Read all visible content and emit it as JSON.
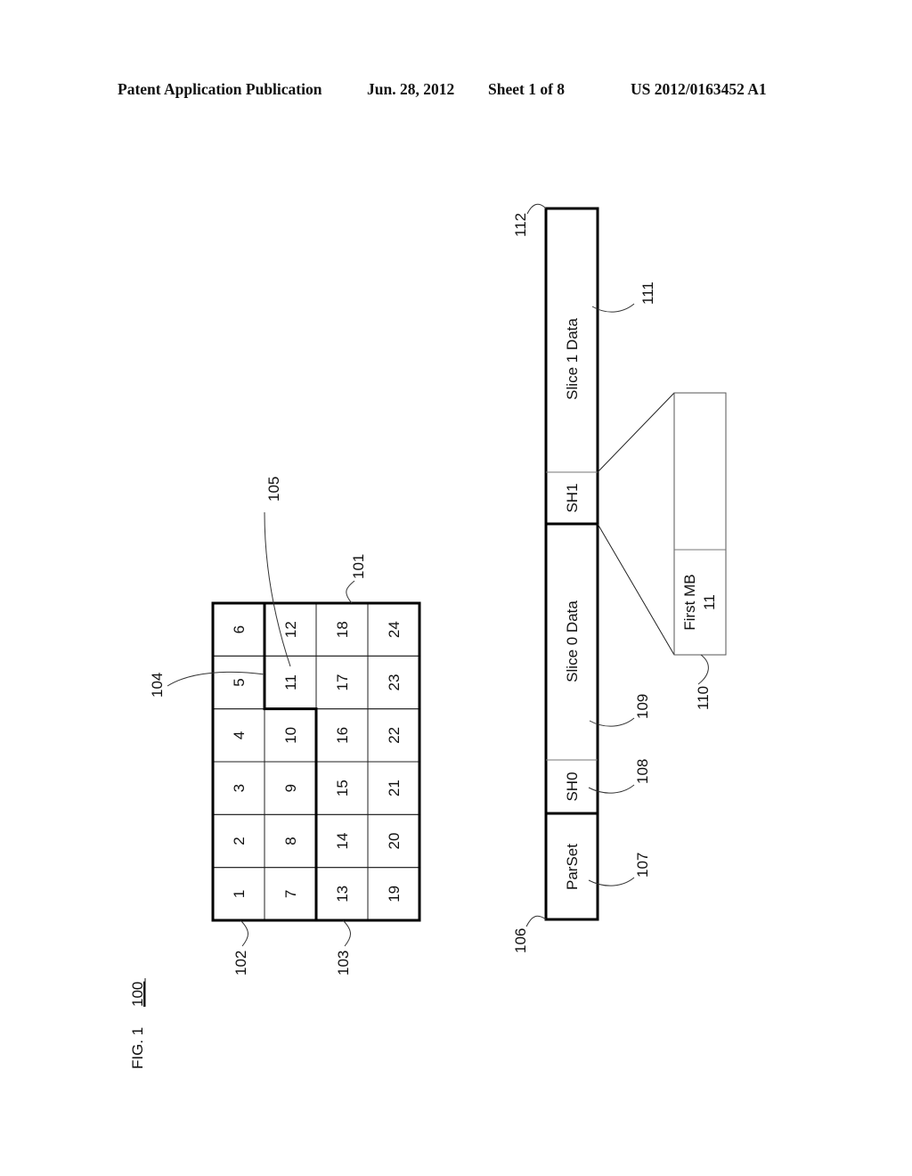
{
  "header": {
    "publication_label": "Patent Application Publication",
    "date": "Jun. 28, 2012",
    "sheet": "Sheet 1 of 8",
    "publication_number": "US 2012/0163452 A1"
  },
  "figure": {
    "label": "FIG. 1",
    "ref": "100"
  },
  "picture_grid": {
    "ref_picture": "101",
    "ref_slice0": "102",
    "ref_slice1": "103",
    "ref_boundary": "104",
    "ref_first_mb": "105",
    "columns": [
      [
        "1",
        "2",
        "3",
        "4",
        "5",
        "6"
      ],
      [
        "7",
        "8",
        "9",
        "10",
        "11",
        "12"
      ],
      [
        "13",
        "14",
        "15",
        "16",
        "17",
        "18"
      ],
      [
        "19",
        "20",
        "21",
        "22",
        "23",
        "24"
      ]
    ]
  },
  "bitstream": {
    "ref_start": "106",
    "ref_end": "112",
    "segments": [
      {
        "label": "ParSet",
        "ref": "107"
      },
      {
        "label": "SH0",
        "ref": "108"
      },
      {
        "label": "Slice 0 Data",
        "ref": "109"
      },
      {
        "label": "SH1",
        "ref": ""
      },
      {
        "label": "Slice 1 Data",
        "ref": "111"
      }
    ]
  },
  "slice_header_detail": {
    "ref": "110",
    "field_label": "First MB",
    "field_value": "11"
  }
}
